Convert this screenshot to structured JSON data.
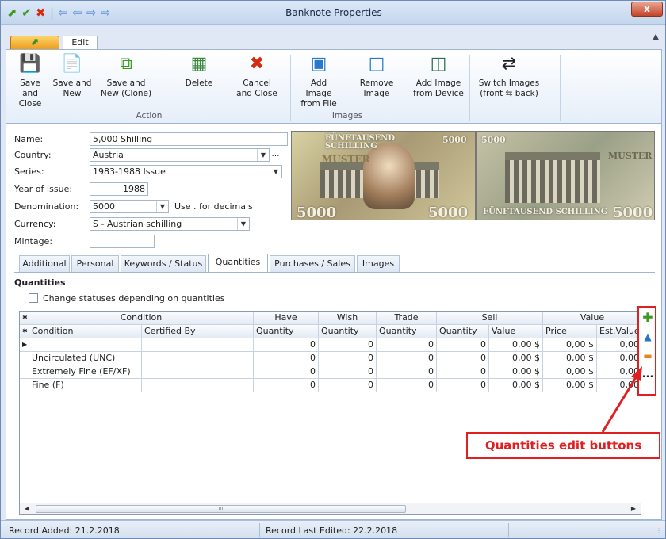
{
  "window": {
    "title": "Banknote Properties",
    "close": "x"
  },
  "quick_access": [
    "⬈",
    "✔",
    "✖",
    "|",
    "⇦",
    "⇦",
    "⇨",
    "⇨"
  ],
  "app_tab": "⬈",
  "ribbon": {
    "tab": "Edit",
    "buttons": [
      {
        "label1": "Save and",
        "label2": "Close"
      },
      {
        "label1": "Save and",
        "label2": "New"
      },
      {
        "label1": "Save and",
        "label2": "New (Clone)"
      },
      {
        "label1": "Delete",
        "label2": ""
      },
      {
        "label1": "Cancel",
        "label2": "and Close"
      },
      {
        "label1": "Add Image",
        "label2": "from File"
      },
      {
        "label1": "Remove",
        "label2": "Image"
      },
      {
        "label1": "Add Image",
        "label2": "from Device"
      },
      {
        "label1": "Switch Images",
        "label2": "(front ⇆ back)"
      }
    ],
    "groups": [
      "Action",
      "Images"
    ]
  },
  "form": {
    "name_label": "Name:",
    "name": "5,000 Shilling",
    "country_label": "Country:",
    "country": "Austria",
    "series_label": "Series:",
    "series": "1983-1988 Issue",
    "year_label": "Year of Issue:",
    "year": "1988",
    "denomination_label": "Denomination:",
    "denomination": "5000",
    "decimals_hint": "Use . for decimals",
    "currency_label": "Currency:",
    "currency": "S - Austrian schilling",
    "mintage_label": "Mintage:",
    "mintage": ""
  },
  "banknote": {
    "front_title": "FÜNFTAUSEND SCHILLING",
    "front_value": "5000",
    "front_specimen": "MUSTER",
    "back_title": "FÜNFTAUSEND SCHILLING",
    "back_value": "5000",
    "back_specimen": "MUSTER"
  },
  "detail_tabs": [
    "Additional",
    "Personal",
    "Keywords / Status",
    "Quantities",
    "Purchases / Sales",
    "Images"
  ],
  "quantities": {
    "section_title": "Quantities",
    "checkbox_label": "Change statuses depending on quantities",
    "group_headers": [
      "Condition",
      "Have",
      "Wish",
      "Trade",
      "Sell",
      "Value"
    ],
    "sub_headers": [
      "Condition",
      "Certified By",
      "Quantity",
      "Quantity",
      "Quantity",
      "Quantity",
      "Value",
      "Price",
      "Est.Value"
    ],
    "rows": [
      [
        "",
        "",
        "0",
        "0",
        "0",
        "0",
        "0,00 $",
        "0,00 $",
        "0,00"
      ],
      [
        "Uncirculated (UNC)",
        "",
        "0",
        "0",
        "0",
        "0",
        "0,00 $",
        "0,00 $",
        "0,00"
      ],
      [
        "Extremely Fine (EF/XF)",
        "",
        "0",
        "0",
        "0",
        "0",
        "0,00 $",
        "0,00 $",
        "0,00"
      ],
      [
        "Fine (F)",
        "",
        "0",
        "0",
        "0",
        "0",
        "0,00 $",
        "0,00 $",
        "0,00"
      ]
    ],
    "scroll_mark": "III"
  },
  "edit_buttons": {
    "add": "✚",
    "up": "▲",
    "remove": "▬",
    "more": "..."
  },
  "callout": "Quantities edit buttons",
  "status": {
    "added": "Record Added: 21.2.2018",
    "edited": "Record Last Edited: 22.2.2018"
  },
  "colors": {
    "accent": "#e02020",
    "ribbon_border": "#9fb5d2",
    "add_green": "#3a9a22",
    "up_blue": "#2a6fc9",
    "remove_orange": "#e8821c"
  }
}
